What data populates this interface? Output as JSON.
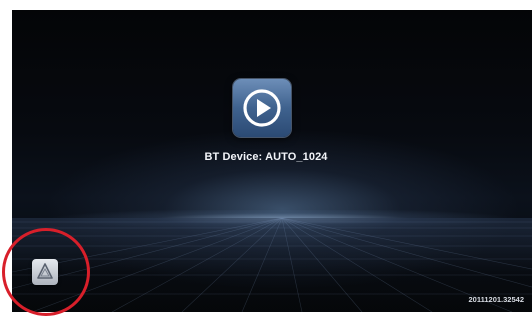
{
  "screen": {
    "app_icon": "play-circle-icon",
    "device_label": "BT Device: AUTO_1024",
    "version": "20111201.32542",
    "android_button_icon": "android-logo-icon",
    "annotation": "highlight-circle"
  },
  "colors": {
    "background": "#070a10",
    "icon_tile": "#4a6a96",
    "annotation_circle": "#d81f2a",
    "text": "#f2f4f8"
  }
}
